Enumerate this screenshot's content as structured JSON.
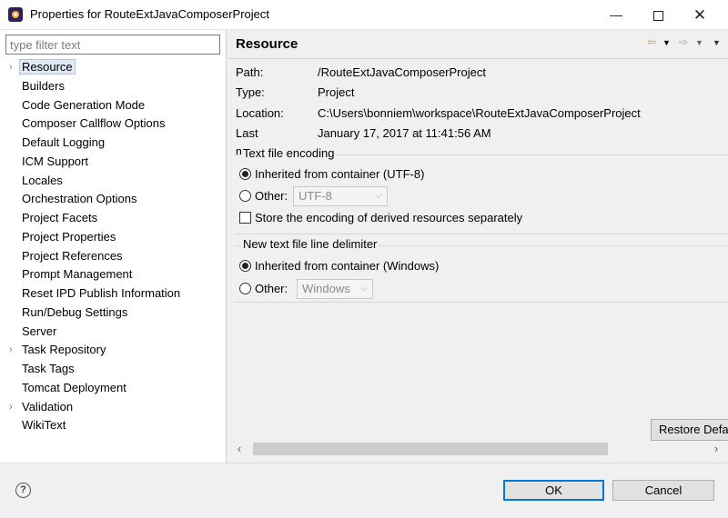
{
  "window": {
    "title": "Properties for RouteExtJavaComposerProject",
    "min_glyph": "—",
    "close_glyph": "✕"
  },
  "sidebar": {
    "filter_placeholder": "type filter text",
    "items": [
      {
        "label": "Resource",
        "expandable": true,
        "selected": true
      },
      {
        "label": "Builders"
      },
      {
        "label": "Code Generation Mode"
      },
      {
        "label": "Composer Callflow Options"
      },
      {
        "label": "Default Logging"
      },
      {
        "label": "ICM Support"
      },
      {
        "label": "Locales"
      },
      {
        "label": "Orchestration Options"
      },
      {
        "label": "Project Facets"
      },
      {
        "label": "Project Properties"
      },
      {
        "label": "Project References"
      },
      {
        "label": "Prompt Management"
      },
      {
        "label": "Reset IPD Publish Information"
      },
      {
        "label": "Run/Debug Settings"
      },
      {
        "label": "Server"
      },
      {
        "label": "Task Repository",
        "expandable": true
      },
      {
        "label": "Task Tags"
      },
      {
        "label": "Tomcat Deployment"
      },
      {
        "label": "Validation",
        "expandable": true
      },
      {
        "label": "WikiText"
      }
    ]
  },
  "page": {
    "title": "Resource",
    "info": {
      "path_label": "Path:",
      "path_value": "/RouteExtJavaComposerProject",
      "type_label": "Type:",
      "type_value": "Project",
      "location_label": "Location:",
      "location_value": "C:\\Users\\bonniem\\workspace\\RouteExtJavaComposerProject",
      "modified_label": "Last modified:",
      "modified_value": "January 17, 2017 at 11:41:56 AM"
    },
    "encoding": {
      "title": "Text file encoding",
      "inherited_label": "Inherited from container (UTF-8)",
      "inherited_selected": true,
      "other_label": "Other:",
      "other_value": "UTF-8",
      "store_label": "Store the encoding of derived resources separately",
      "store_checked": false
    },
    "delimiter": {
      "title": "New text file line delimiter",
      "inherited_label": "Inherited from container (Windows)",
      "inherited_selected": true,
      "other_label": "Other:",
      "other_value": "Windows"
    },
    "restore_label": "Restore Defa"
  },
  "footer": {
    "help_glyph": "?",
    "ok_label": "OK",
    "cancel_label": "Cancel"
  }
}
